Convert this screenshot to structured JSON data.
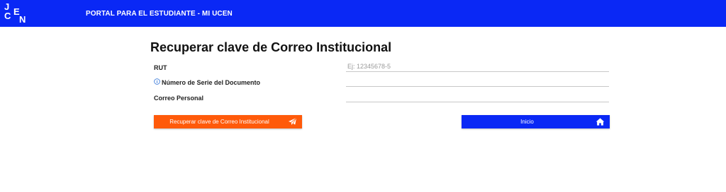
{
  "header": {
    "logo_letters": [
      "J",
      "C",
      "E",
      "N"
    ],
    "title": "PORTAL PARA EL ESTUDIANTE - MI UCEN",
    "background_color": "#0a28f5"
  },
  "form": {
    "heading": "Recuperar clave de Correo Institucional",
    "fields": [
      {
        "label": "RUT",
        "value": "",
        "placeholder": "Ej: 12345678-5"
      },
      {
        "label": "Número de Serie del Documento",
        "icon": "info-icon",
        "value": "",
        "placeholder": ""
      },
      {
        "label": "Correo Personal",
        "value": "",
        "placeholder": ""
      }
    ]
  },
  "buttons": {
    "recover": {
      "label": "Recuperar clave de Correo Institucional",
      "icon": "paper-plane-icon",
      "color": "#ff5a0a"
    },
    "home": {
      "label": "Inicio",
      "icon": "home-icon",
      "color": "#0a28f5"
    }
  }
}
